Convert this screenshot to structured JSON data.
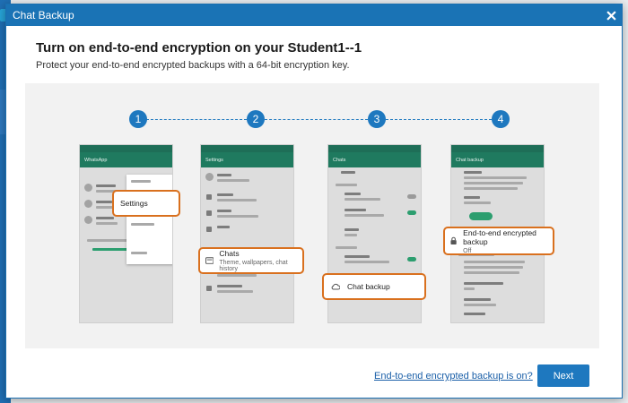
{
  "window": {
    "title": "Chat Backup"
  },
  "header": {
    "headline": "Turn on end-to-end encryption on your Student1--1",
    "subline": "Protect your end-to-end encrypted backups with a 64-bit encryption key."
  },
  "steps": [
    "1",
    "2",
    "3",
    "4"
  ],
  "phones": {
    "p1": {
      "app_title": "WhatsApp",
      "callout": "Settings"
    },
    "p2": {
      "app_title": "Settings",
      "callout_title": "Chats",
      "callout_sub": "Theme, wallpapers, chat history"
    },
    "p3": {
      "app_title": "Chats",
      "callout": "Chat backup"
    },
    "p4": {
      "app_title": "Chat backup",
      "callout_title": "End-to-end encrypted backup",
      "callout_sub": "Off"
    }
  },
  "footer": {
    "link": "End-to-end encrypted backup is on?",
    "next_label": "Next"
  },
  "colors": {
    "titlebar": "#1a73b5",
    "accent": "#1e78bf",
    "callout_border": "#d9701e",
    "whatsapp_green": "#1f7a5f"
  }
}
